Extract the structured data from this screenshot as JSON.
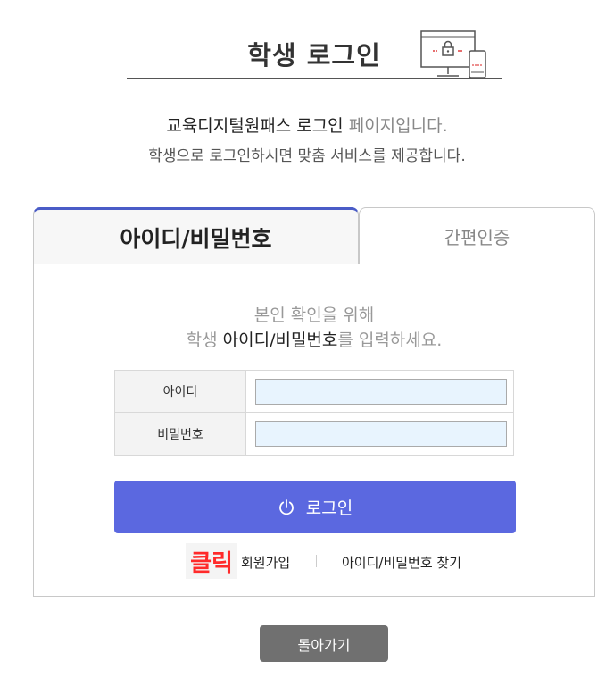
{
  "header": {
    "title": "학생 로그인",
    "illustration_icon": "computer-lock-icon"
  },
  "intro": {
    "line1_strong": "교육디지털원패스 로그인",
    "line1_light": " 페이지입니다.",
    "line2": "학생으로 로그인하시면 맞춤 서비스를 제공합니다."
  },
  "tabs": [
    {
      "label": "아이디/비밀번호",
      "active": true
    },
    {
      "label": "간편인증",
      "active": false
    }
  ],
  "guide": {
    "line1": "본인 확인을 위해",
    "line2_prefix": "학생 ",
    "line2_strong": "아이디/비밀번호",
    "line2_suffix": "를 입력하세요."
  },
  "form": {
    "id_label": "아이디",
    "id_value": "",
    "password_label": "비밀번호",
    "password_value": ""
  },
  "login_button": {
    "label": "로그인",
    "icon": "power-icon"
  },
  "links": {
    "click_badge": "클릭",
    "signup": "회원가입",
    "find": "아이디/비밀번호 찾기"
  },
  "back_button": {
    "label": "돌아가기"
  },
  "colors": {
    "accent": "#5b68e0",
    "tab_border": "#4a5cc7",
    "click_red": "#ff2a2a",
    "back_button": "#707070"
  }
}
